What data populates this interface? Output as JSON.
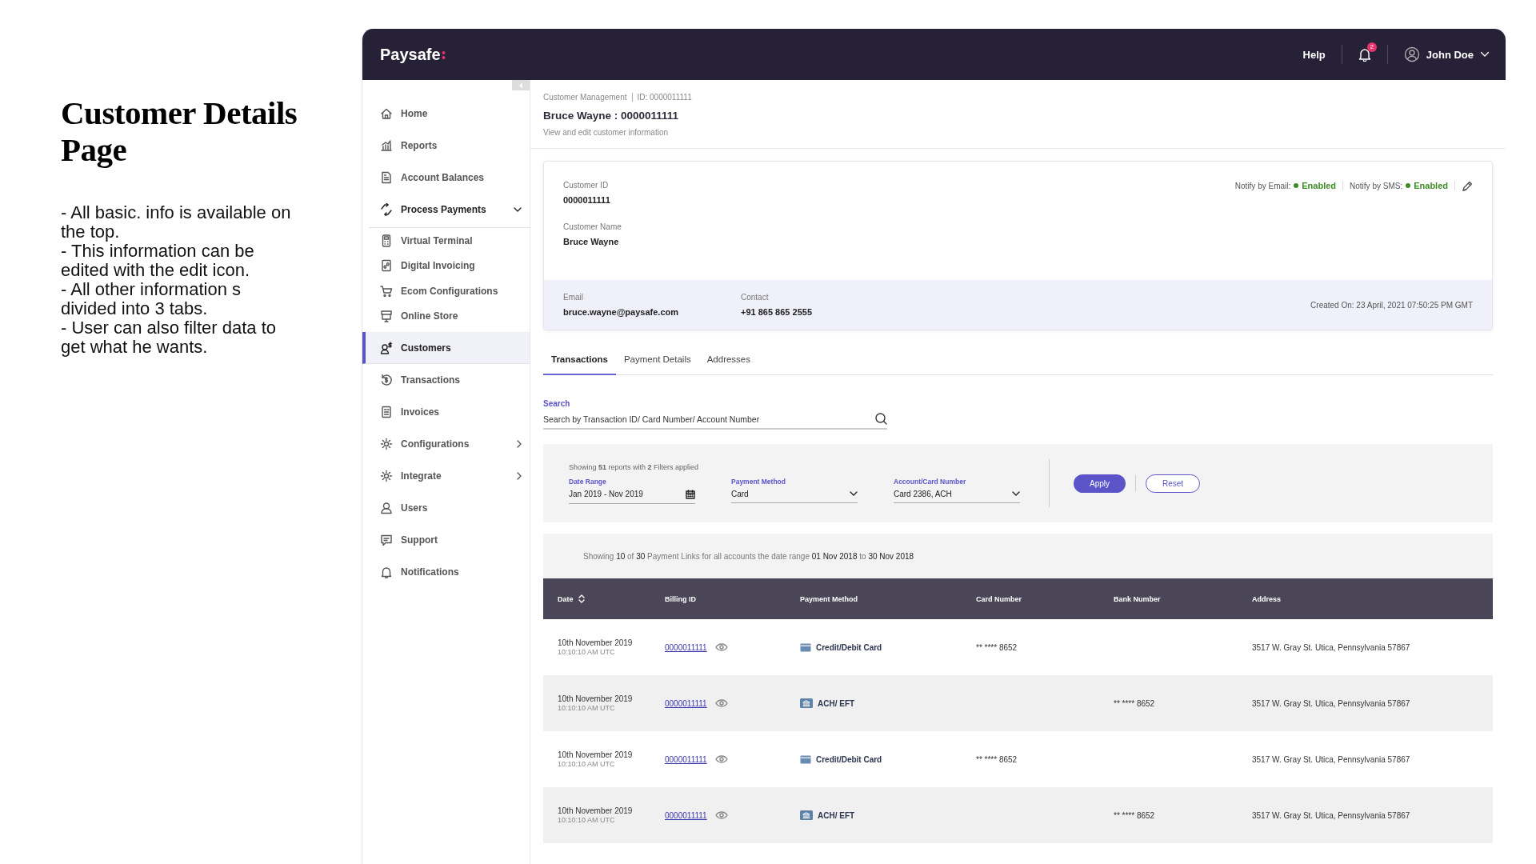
{
  "notes": {
    "title": "Customer Details Page",
    "bullets": [
      "- All basic. info is available on the top.",
      "- This information can be edited with the edit icon.",
      "- All other information s divided into 3 tabs.",
      "- User can also filter data to get what he wants."
    ]
  },
  "top_bar": {
    "logo": "Paysafe",
    "help": "Help",
    "notifications_badge": "2",
    "user": "John Doe"
  },
  "sidebar": {
    "items": [
      {
        "label": "Home",
        "selected": false
      },
      {
        "label": "Reports",
        "selected": false
      },
      {
        "label": "Account Balances",
        "selected": false
      },
      {
        "label": "Process Payments",
        "selected": false,
        "expanded": true,
        "children": [
          {
            "label": "Virtual Terminal",
            "selected": false
          },
          {
            "label": "Digital Invoicing",
            "selected": false
          },
          {
            "label": "Ecom Configurations",
            "selected": false
          },
          {
            "label": "Online Store",
            "selected": false
          }
        ]
      },
      {
        "label": "Customers",
        "selected": true
      },
      {
        "label": "Transactions",
        "selected": false
      },
      {
        "label": "Invoices",
        "selected": false
      },
      {
        "label": "Configurations",
        "selected": false,
        "expanded": false
      },
      {
        "label": "Integrate",
        "selected": false,
        "expanded": false
      },
      {
        "label": "Users",
        "selected": false
      },
      {
        "label": "Support",
        "selected": false
      },
      {
        "label": "Notifications",
        "selected": false
      }
    ]
  },
  "header": {
    "breadcrumb": [
      "Customer Management",
      "ID: 0000011111"
    ],
    "title": "Bruce Wayne : 0000011111",
    "subtitle": "View and edit customer information"
  },
  "customer_card": {
    "fields": [
      {
        "label": "Customer ID",
        "value": "0000011111"
      },
      {
        "label": "Customer Name",
        "value": "Bruce Wayne"
      }
    ],
    "notify": [
      {
        "label": "Notify by Email:",
        "status": "Enabled",
        "on": true
      },
      {
        "label": "Notify by SMS:",
        "status": "Enabled",
        "on": true
      }
    ],
    "contact_fields": [
      {
        "label": "Email",
        "value": "bruce.wayne@paysafe.com"
      },
      {
        "label": "Contact",
        "value": "+91 865 865 2555"
      }
    ],
    "created": "Created On: 23 April, 2021 07:50:25 PM GMT"
  },
  "tabs": [
    {
      "label": "Transactions",
      "selected": true
    },
    {
      "label": "Payment Details",
      "selected": false
    },
    {
      "label": "Addresses",
      "selected": false
    }
  ],
  "search": {
    "label": "Search",
    "placeholder": "Search by Transaction ID/ Card Number/ Account Number"
  },
  "filters": {
    "summary": "Showing **51** reports with **2** Filters applied",
    "fields": [
      {
        "label": "Date Range",
        "value": "Jan 2019 - Nov 2019",
        "kind": "date"
      },
      {
        "label": "Payment Method",
        "value": "Card",
        "kind": "select"
      },
      {
        "label": "Account/Card Number",
        "value": "Card 2386, ACH",
        "kind": "select"
      }
    ],
    "apply": "Apply",
    "reset": "Reset"
  },
  "results_summary": "Showing **10** of **30** Payment Links for all accounts  the date range **01 Nov 2018** to **30 Nov 2018**",
  "table": {
    "columns": [
      "Date",
      "Billing ID",
      "Payment Method",
      "Card Number",
      "Bank Number",
      "Address"
    ],
    "rows": [
      {
        "date": "10th November 2019",
        "time": "10:10:10 AM UTC",
        "billing_id": "0000011111",
        "method": "Credit/Debit Card",
        "kind": "card",
        "card_number": "** **** 8652",
        "address": "3517 W. Gray St. Utica, Pennsylvania 57867"
      },
      {
        "date": "10th November 2019",
        "time": "10:10:10 AM UTC",
        "billing_id": "0000011111",
        "method": "ACH/ EFT",
        "kind": "ach",
        "bank_number": "** **** 8652",
        "address": "3517 W. Gray St. Utica, Pennsylvania 57867"
      },
      {
        "date": "10th November 2019",
        "time": "10:10:10 AM UTC",
        "billing_id": "0000011111",
        "method": "Credit/Debit Card",
        "kind": "card",
        "card_number": "** **** 8652",
        "address": "3517 W. Gray St. Utica, Pennsylvania 57867"
      },
      {
        "date": "10th November 2019",
        "time": "10:10:10 AM UTC",
        "billing_id": "0000011111",
        "method": "ACH/ EFT",
        "kind": "ach",
        "bank_number": "** **** 8652",
        "address": "3517 W. Gray St. Utica, Pennsylvania 57867"
      }
    ]
  }
}
